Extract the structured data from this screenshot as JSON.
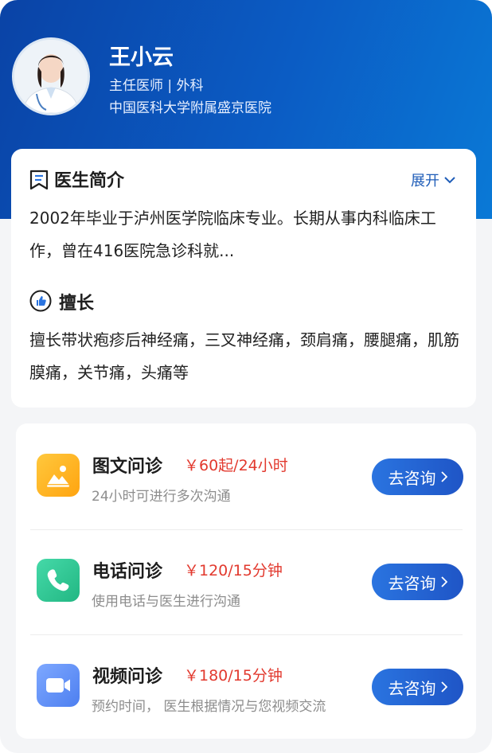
{
  "doctor": {
    "name": "王小云",
    "title": "主任医师 | 外科",
    "hospital": "中国医科大学附属盛京医院"
  },
  "intro": {
    "heading": "医生简介",
    "expand_label": "展开",
    "text": "2002年毕业于泸州医学院临床专业。长期从事内科临床工作，曾在416医院急诊科就..."
  },
  "specialty": {
    "heading": "擅长",
    "text": "擅长带状疱疹后神经痛，三叉神经痛，颈肩痛，腰腿痛，肌筋膜痛，关节痛，头痛等"
  },
  "services": [
    {
      "name": "图文问诊",
      "price": "￥60起/24小时",
      "desc": "24小时可进行多次沟通",
      "button": "去咨询",
      "icon": "image-chat-icon",
      "color": "#ffb21f"
    },
    {
      "name": "电话问诊",
      "price": "￥120/15分钟",
      "desc": "使用电话与医生进行沟通",
      "button": "去咨询",
      "icon": "phone-icon",
      "color": "#2fc494"
    },
    {
      "name": "视频问诊",
      "price": "￥180/15分钟",
      "desc": "预约时间， 医生根据情况与您视频交流",
      "button": "去咨询",
      "icon": "video-icon",
      "color": "#5b8ff5"
    }
  ],
  "colors": {
    "header": "#0b5cc4",
    "price": "#e2392e",
    "button": "#2a74e0"
  }
}
